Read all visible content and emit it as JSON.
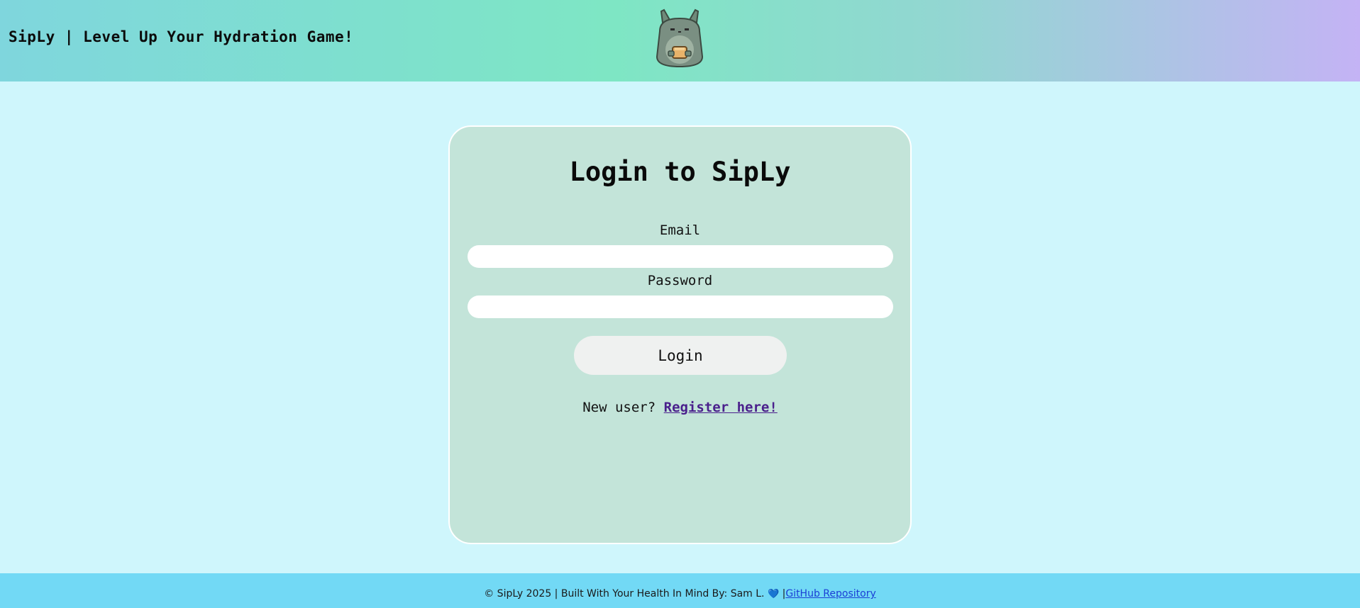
{
  "header": {
    "title": "SipLy | Level Up Your Hydration Game!",
    "mascot_icon": "totoro-mascot-icon"
  },
  "login_card": {
    "title": "Login to SipLy",
    "email_label": "Email",
    "email_value": "",
    "password_label": "Password",
    "password_value": "",
    "login_button": "Login",
    "register_prompt": "New user?",
    "register_link": "Register here!"
  },
  "footer": {
    "text": "© SipLy 2025 | Built With Your Health In Mind By: Sam L.",
    "heart_icon": "heart-icon",
    "separator": "|",
    "repo_link": "GitHub Repository"
  },
  "colors": {
    "page_bg": "#cff6fc",
    "card_bg": "#c3e4d9",
    "footer_bg": "#72d9f5",
    "link_purple": "#4a1f8c",
    "link_blue": "#1b3fd6"
  }
}
